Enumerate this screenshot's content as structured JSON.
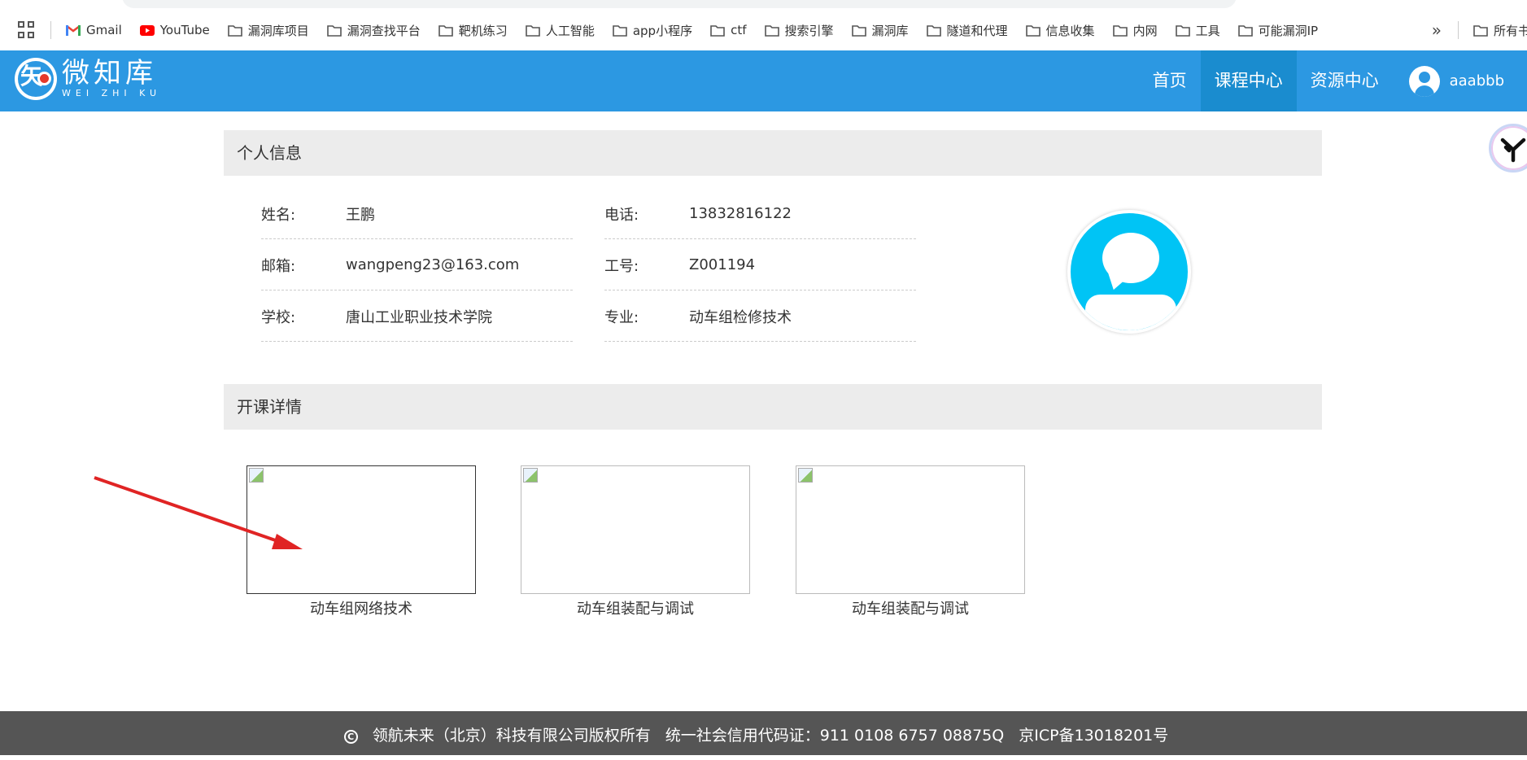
{
  "bookmarks": [
    {
      "label": "Gmail",
      "icon": "gmail-icon"
    },
    {
      "label": "YouTube",
      "icon": "youtube-icon"
    },
    {
      "label": "漏洞库项目",
      "icon": "folder-icon"
    },
    {
      "label": "漏洞查找平台",
      "icon": "folder-icon"
    },
    {
      "label": "靶机练习",
      "icon": "folder-icon"
    },
    {
      "label": "人工智能",
      "icon": "folder-icon"
    },
    {
      "label": "app小程序",
      "icon": "folder-icon"
    },
    {
      "label": "ctf",
      "icon": "folder-icon"
    },
    {
      "label": "搜索引擎",
      "icon": "folder-icon"
    },
    {
      "label": "漏洞库",
      "icon": "folder-icon"
    },
    {
      "label": "隧道和代理",
      "icon": "folder-icon"
    },
    {
      "label": "信息收集",
      "icon": "folder-icon"
    },
    {
      "label": "内网",
      "icon": "folder-icon"
    },
    {
      "label": "工具",
      "icon": "folder-icon"
    },
    {
      "label": "可能漏洞IP",
      "icon": "folder-icon"
    }
  ],
  "bookmarks_more": "»",
  "bookmarks_all": "所有书签",
  "site": {
    "logo_cn": "微知库",
    "logo_en": "WEI ZHI KU",
    "nav": [
      "首页",
      "课程中心",
      "资源中心"
    ],
    "active_nav": "课程中心",
    "username": "aaabbb"
  },
  "profile": {
    "section_title": "个人信息",
    "fields": {
      "name": {
        "label": "姓名:",
        "value": "王鹏"
      },
      "phone": {
        "label": "电话:",
        "value": "13832816122"
      },
      "email": {
        "label": "邮箱:",
        "value": "wangpeng23@163.com"
      },
      "employee_id": {
        "label": "工号:",
        "value": "Z001194"
      },
      "school": {
        "label": "学校:",
        "value": "唐山工业职业技术学院"
      },
      "major": {
        "label": "专业:",
        "value": "动车组检修技术"
      }
    }
  },
  "courses": {
    "section_title": "开课详情",
    "items": [
      {
        "title": "动车组网络技术"
      },
      {
        "title": "动车组装配与调试"
      },
      {
        "title": "动车组装配与调试"
      }
    ]
  },
  "footer": {
    "copyright": "领航未来（北京）科技有限公司版权所有",
    "credit_code": "统一社会信用代码证：911 0108 6757 08875Q",
    "icp": "京ICP备13018201号"
  },
  "colors": {
    "header": "#2c98e2",
    "nav_active": "#1a8ccf",
    "annotation_arrow": "#e02424",
    "footer": "#555555"
  }
}
